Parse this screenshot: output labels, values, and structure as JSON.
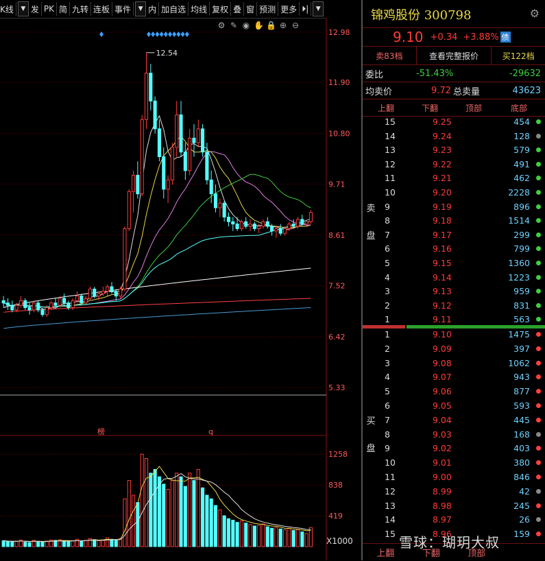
{
  "toolbar": {
    "items": [
      "K线",
      "发",
      "PK",
      "简",
      "九转",
      "连板",
      "事件",
      "内",
      "加自选",
      "均线",
      "复权",
      "叠",
      "窗",
      "预测",
      "更多"
    ],
    "close": "✕"
  },
  "chart": {
    "price_axis": [
      "12.98",
      "11.90",
      "10.80",
      "9.71",
      "8.61",
      "7.52",
      "6.42",
      "5.33"
    ],
    "volume_axis": [
      "1258",
      "838",
      "419"
    ],
    "volume_unit": "X1000",
    "peak_label": "12.54",
    "event_labels": [
      "榜",
      "q"
    ],
    "colors": {
      "up": "#ff3b3b",
      "down": "#54ffff",
      "bg": "#000000",
      "grid": "#7a0000"
    },
    "tool_icons": [
      "settings-icon",
      "pen-icon",
      "eye-icon",
      "hand-icon",
      "lock-icon",
      "zoom-in-icon",
      "zoom-out-icon"
    ]
  },
  "chart_data": {
    "type": "candlestick",
    "price_ylim": [
      5.33,
      12.98
    ],
    "candles": [
      [
        7.2,
        7.3,
        7.05,
        7.15
      ],
      [
        7.15,
        7.25,
        7.0,
        7.1
      ],
      [
        7.1,
        7.2,
        6.95,
        7.0
      ],
      [
        7.0,
        7.15,
        6.95,
        7.1
      ],
      [
        7.1,
        7.3,
        7.05,
        7.2
      ],
      [
        7.2,
        7.25,
        7.0,
        7.05
      ],
      [
        7.05,
        7.15,
        6.9,
        7.0
      ],
      [
        7.0,
        7.2,
        6.95,
        7.15
      ],
      [
        7.15,
        7.2,
        6.95,
        7.0
      ],
      [
        7.0,
        7.05,
        6.85,
        6.9
      ],
      [
        6.9,
        7.1,
        6.85,
        7.05
      ],
      [
        7.05,
        7.2,
        7.0,
        7.15
      ],
      [
        7.15,
        7.25,
        7.05,
        7.1
      ],
      [
        7.1,
        7.3,
        7.05,
        7.25
      ],
      [
        7.25,
        7.35,
        7.1,
        7.15
      ],
      [
        7.15,
        7.2,
        7.0,
        7.05
      ],
      [
        7.05,
        7.25,
        7.0,
        7.2
      ],
      [
        7.2,
        7.4,
        7.15,
        7.3
      ],
      [
        7.3,
        7.35,
        7.1,
        7.15
      ],
      [
        7.15,
        7.3,
        7.1,
        7.25
      ],
      [
        7.25,
        7.5,
        7.2,
        7.45
      ],
      [
        7.45,
        7.5,
        7.25,
        7.3
      ],
      [
        7.3,
        7.4,
        7.2,
        7.35
      ],
      [
        7.35,
        7.5,
        7.3,
        7.4
      ],
      [
        7.4,
        7.55,
        7.3,
        7.5
      ],
      [
        7.5,
        7.6,
        7.35,
        7.4
      ],
      [
        7.4,
        7.45,
        7.2,
        7.3
      ],
      [
        7.3,
        7.5,
        7.25,
        7.45
      ],
      [
        7.45,
        8.8,
        7.4,
        8.75
      ],
      [
        8.75,
        9.6,
        8.7,
        9.55
      ],
      [
        9.55,
        10.0,
        9.1,
        9.9
      ],
      [
        9.9,
        10.2,
        9.4,
        9.5
      ],
      [
        9.5,
        11.2,
        9.45,
        11.1
      ],
      [
        11.1,
        12.54,
        10.9,
        12.1
      ],
      [
        12.1,
        12.3,
        11.3,
        11.5
      ],
      [
        11.5,
        11.6,
        10.8,
        10.9
      ],
      [
        10.9,
        11.1,
        10.2,
        10.3
      ],
      [
        10.3,
        10.5,
        9.4,
        9.6
      ],
      [
        9.6,
        9.9,
        9.3,
        9.8
      ],
      [
        9.8,
        10.6,
        9.7,
        10.5
      ],
      [
        10.5,
        11.5,
        10.3,
        11.2
      ],
      [
        11.2,
        11.5,
        10.3,
        10.4
      ],
      [
        10.4,
        10.6,
        9.8,
        10.0
      ],
      [
        10.0,
        10.9,
        9.9,
        10.7
      ],
      [
        10.7,
        11.0,
        10.3,
        10.6
      ],
      [
        10.6,
        11.1,
        10.5,
        10.9
      ],
      [
        10.9,
        11.0,
        10.3,
        10.4
      ],
      [
        10.4,
        10.6,
        9.7,
        9.8
      ],
      [
        9.8,
        10.0,
        9.3,
        9.5
      ],
      [
        9.5,
        9.7,
        9.1,
        9.2
      ],
      [
        9.2,
        9.4,
        9.0,
        9.3
      ],
      [
        9.3,
        9.35,
        8.9,
        9.0
      ],
      [
        9.0,
        9.1,
        8.8,
        8.9
      ],
      [
        8.9,
        9.0,
        8.7,
        8.85
      ],
      [
        8.85,
        9.0,
        8.7,
        8.75
      ],
      [
        8.75,
        8.95,
        8.7,
        8.9
      ],
      [
        8.9,
        9.0,
        8.75,
        8.8
      ],
      [
        8.8,
        8.95,
        8.7,
        8.85
      ],
      [
        8.85,
        8.9,
        8.7,
        8.75
      ],
      [
        8.75,
        8.85,
        8.65,
        8.8
      ],
      [
        8.8,
        8.95,
        8.75,
        8.9
      ],
      [
        8.9,
        9.0,
        8.75,
        8.8
      ],
      [
        8.8,
        8.85,
        8.6,
        8.7
      ],
      [
        8.7,
        8.8,
        8.55,
        8.75
      ],
      [
        8.75,
        8.85,
        8.6,
        8.65
      ],
      [
        8.65,
        8.8,
        8.6,
        8.75
      ],
      [
        8.75,
        8.9,
        8.7,
        8.85
      ],
      [
        8.85,
        8.95,
        8.75,
        8.8
      ],
      [
        8.8,
        9.0,
        8.75,
        8.95
      ],
      [
        8.95,
        9.05,
        8.8,
        8.85
      ],
      [
        8.85,
        8.95,
        8.8,
        8.9
      ],
      [
        8.9,
        9.15,
        8.85,
        9.1
      ]
    ],
    "volumes": [
      80,
      70,
      65,
      75,
      90,
      60,
      55,
      85,
      70,
      60,
      75,
      90,
      85,
      95,
      70,
      65,
      80,
      100,
      75,
      85,
      110,
      95,
      80,
      90,
      120,
      100,
      85,
      110,
      650,
      900,
      700,
      600,
      1258,
      1200,
      1000,
      1050,
      950,
      850,
      780,
      900,
      1000,
      950,
      820,
      1000,
      900,
      1050,
      800,
      700,
      650,
      560,
      500,
      420,
      380,
      360,
      330,
      350,
      320,
      300,
      280,
      290,
      310,
      270,
      250,
      260,
      240,
      230,
      250,
      220,
      230,
      200,
      180,
      260
    ]
  },
  "quote": {
    "name": "锦鸡股份",
    "code": "300798",
    "price": "9.10",
    "change": "+0.34",
    "change_pct": "+3.88%",
    "badge": "债",
    "tab_sell": "卖83档",
    "tab_full": "查看完整报价",
    "tab_buy": "买122档",
    "weibi_label": "委比",
    "weibi_pct": "-51.43%",
    "weibi_val": "-29632",
    "avg_sell_label": "均卖价",
    "avg_sell_price": "9.72",
    "total_sell_label": "总卖量",
    "total_sell_vol": "43623",
    "col_up": "上翻",
    "col_down": "下翻",
    "col_top": "顶部",
    "col_bottom": "底部",
    "sell_label_1": "卖",
    "sell_label_2": "盘",
    "buy_label_1": "买",
    "buy_label_2": "盘",
    "sell_book": [
      [
        "15",
        "9.25",
        "454",
        "#3ecf3e"
      ],
      [
        "14",
        "9.24",
        "128",
        "#888888"
      ],
      [
        "13",
        "9.23",
        "579",
        "#3ecf3e"
      ],
      [
        "12",
        "9.22",
        "491",
        "#3ecf3e"
      ],
      [
        "11",
        "9.21",
        "462",
        "#3ecf3e"
      ],
      [
        "10",
        "9.20",
        "2228",
        "#3ecf3e"
      ],
      [
        "9",
        "9.19",
        "896",
        "#3ecf3e"
      ],
      [
        "8",
        "9.18",
        "1514",
        "#3ecf3e"
      ],
      [
        "7",
        "9.17",
        "299",
        "#3ecf3e"
      ],
      [
        "6",
        "9.16",
        "799",
        "#3ecf3e"
      ],
      [
        "5",
        "9.15",
        "1360",
        "#3ecf3e"
      ],
      [
        "4",
        "9.14",
        "1223",
        "#3ecf3e"
      ],
      [
        "3",
        "9.13",
        "959",
        "#3ecf3e"
      ],
      [
        "2",
        "9.12",
        "831",
        "#3ecf3e"
      ],
      [
        "1",
        "9.11",
        "563",
        "#3ecf3e"
      ]
    ],
    "buy_book": [
      [
        "1",
        "9.10",
        "1475",
        "#ff4040"
      ],
      [
        "2",
        "9.09",
        "397",
        "#ff4040"
      ],
      [
        "3",
        "9.08",
        "1062",
        "#ff4040"
      ],
      [
        "4",
        "9.07",
        "943",
        "#ff4040"
      ],
      [
        "5",
        "9.06",
        "877",
        "#ff4040"
      ],
      [
        "6",
        "9.05",
        "593",
        "#ff4040"
      ],
      [
        "7",
        "9.04",
        "445",
        "#ff4040"
      ],
      [
        "8",
        "9.03",
        "168",
        "#888888"
      ],
      [
        "9",
        "9.02",
        "403",
        "#ff4040"
      ],
      [
        "10",
        "9.01",
        "380",
        "#ff4040"
      ],
      [
        "11",
        "9.00",
        "846",
        "#ff4040"
      ],
      [
        "12",
        "8.99",
        "42",
        "#888888"
      ],
      [
        "13",
        "8.98",
        "245",
        "#ff4040"
      ],
      [
        "14",
        "8.97",
        "26",
        "#888888"
      ],
      [
        "15",
        "8.96",
        "159",
        "#ff4040"
      ]
    ],
    "bottom_up": "上翻",
    "bottom_down": "下翻",
    "bottom_top": "顶部",
    "watermark": "雪球：瑚玥大叔"
  }
}
